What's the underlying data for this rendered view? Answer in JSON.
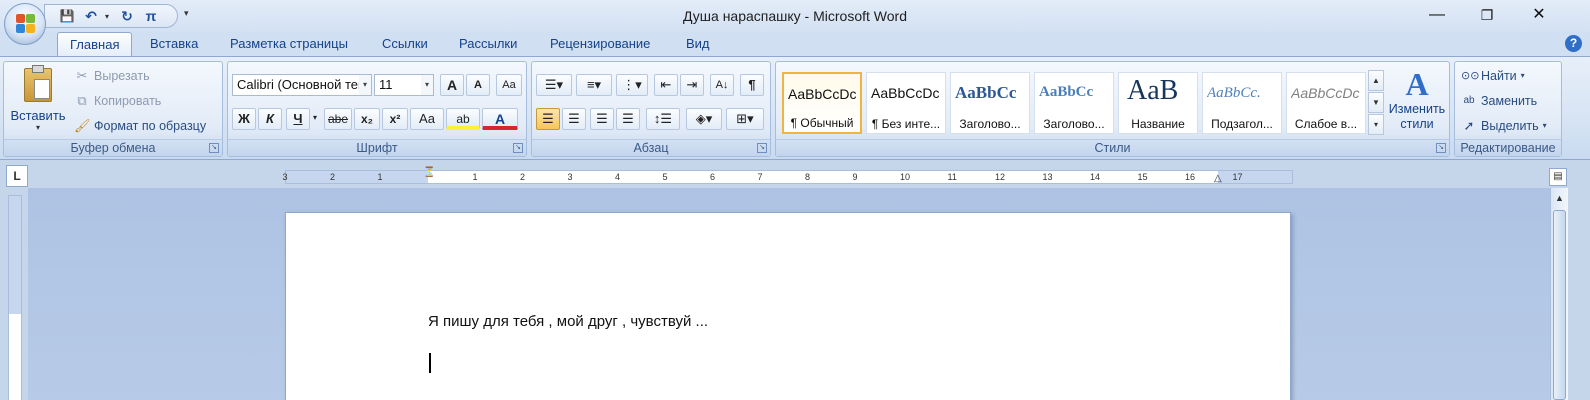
{
  "window": {
    "title": "Душа нараспашку - Microsoft Word",
    "minimize": "—",
    "restore": "❐",
    "close": "✕"
  },
  "qat": {
    "save": "💾",
    "undo": "↶",
    "redo": "↻",
    "pi": "π",
    "more": "▾"
  },
  "tabs": [
    "Главная",
    "Вставка",
    "Разметка страницы",
    "Ссылки",
    "Рассылки",
    "Рецензирование",
    "Вид"
  ],
  "help": "?",
  "clipboard": {
    "paste": "Вставить",
    "cut": "Вырезать",
    "copy": "Копировать",
    "format_painter": "Формат по образцу",
    "label": "Буфер обмена"
  },
  "font": {
    "name": "Calibri (Основной текст)",
    "size": "11",
    "grow": "A",
    "shrink": "A",
    "clear": "Aa",
    "bold": "Ж",
    "italic": "К",
    "underline": "Ч",
    "strike": "abe",
    "subscript": "x₂",
    "superscript": "x²",
    "case": "Aa",
    "highlight": "ab",
    "color": "A",
    "label": "Шрифт"
  },
  "paragraph": {
    "label": "Абзац",
    "show_marks": "¶"
  },
  "styles": {
    "items": [
      {
        "sample": "AaBbCcDc",
        "name": "¶ Обычный"
      },
      {
        "sample": "AaBbCcDc",
        "name": "¶ Без инте..."
      },
      {
        "sample": "AaBbCc",
        "name": "Заголово..."
      },
      {
        "sample": "AaBbCc",
        "name": "Заголово..."
      },
      {
        "sample": "AaB",
        "name": "Название"
      },
      {
        "sample": "AaBbCc.",
        "name": "Подзагол..."
      },
      {
        "sample": "AaBbCcDc",
        "name": "Слабое в..."
      }
    ],
    "change": "Изменить стили",
    "label": "Стили"
  },
  "editing": {
    "find": "Найти",
    "replace": "Заменить",
    "select": "Выделить",
    "label": "Редактирование"
  },
  "ruler": {
    "corner": "L",
    "ticks": [
      "3",
      "2",
      "1",
      "1",
      "2",
      "3",
      "4",
      "5",
      "6",
      "7",
      "8",
      "9",
      "10",
      "11",
      "12",
      "13",
      "14",
      "15",
      "16",
      "17"
    ]
  },
  "colors": {
    "accent": "#15428b",
    "selected_style": "#f2b440",
    "font_color": "#d4262b",
    "highlight": "#ffee3a"
  },
  "document": {
    "line1": "Я пишу для тебя , мой друг , чувствуй ..."
  }
}
